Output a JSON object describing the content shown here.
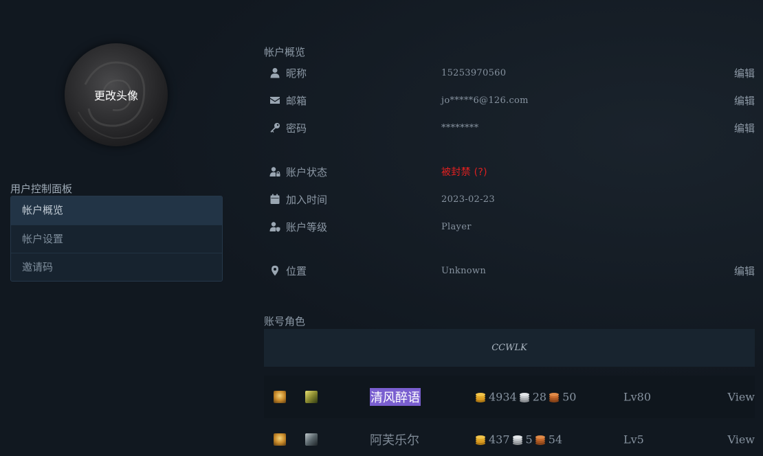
{
  "avatar": {
    "change_label": "更改头像"
  },
  "sidebar": {
    "title": "用户控制面板",
    "items": [
      {
        "label": "帐户概览",
        "active": true
      },
      {
        "label": "帐户设置",
        "active": false
      },
      {
        "label": "邀请码",
        "active": false
      }
    ]
  },
  "overview": {
    "title": "帐户概览",
    "rows": [
      {
        "icon": "user-icon",
        "label": "昵称",
        "value": "15253970560",
        "edit": "编辑"
      },
      {
        "icon": "envelope-icon",
        "label": "邮箱",
        "value": "jo*****6@126.com",
        "edit": "编辑"
      },
      {
        "icon": "key-icon",
        "label": "密码",
        "value": "********",
        "edit": "编辑"
      },
      {
        "icon": "user-lock-icon",
        "label": "账户状态",
        "value": "被封禁 (?)",
        "edit": ""
      },
      {
        "icon": "calendar-icon",
        "label": "加入时间",
        "value": "2023-02-23",
        "edit": ""
      },
      {
        "icon": "user-shield-icon",
        "label": "账户等级",
        "value": "Player",
        "edit": ""
      },
      {
        "icon": "map-marker-icon",
        "label": "位置",
        "value": "Unknown",
        "edit": "编辑"
      }
    ]
  },
  "characters": {
    "title": "账号角色",
    "realm": "CCWLK",
    "list": [
      {
        "race_icon": "race-human-female-icon",
        "class_icon": "class-hunter-icon",
        "name": "清风醉语",
        "gold": "4934",
        "silver": "28",
        "copper": "50",
        "level": "Lv80",
        "view": "View",
        "selected": true
      },
      {
        "race_icon": "race-human-female-icon",
        "class_icon": "class-rogue-icon",
        "name": "阿芙乐尔",
        "gold": "437",
        "silver": "5",
        "copper": "54",
        "level": "Lv5",
        "view": "View",
        "selected": false
      }
    ]
  },
  "colors": {
    "background": "#111820",
    "banned": "#e02020",
    "selection": "#7a5fd0",
    "gold_coin": "#e0a82a",
    "silver_coin": "#c4c8cc",
    "copper_coin": "#c76a2c"
  }
}
